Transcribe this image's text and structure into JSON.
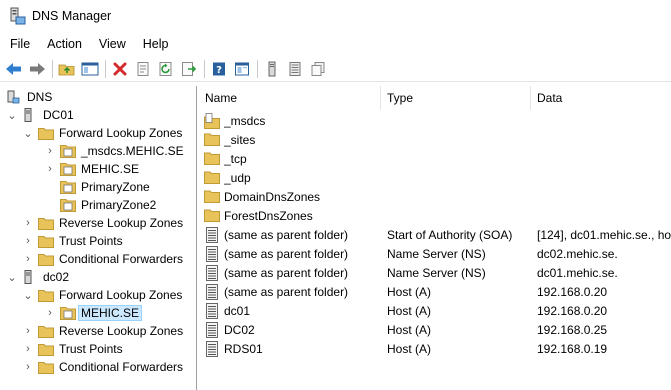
{
  "window": {
    "title": "DNS Manager"
  },
  "menu": [
    "File",
    "Action",
    "View",
    "Help"
  ],
  "toolbar": {
    "buttons": [
      "back-icon",
      "forward-icon",
      "up-folder-icon",
      "show-hide-tree-icon",
      "delete-icon",
      "properties-icon",
      "refresh-icon",
      "export-list-icon",
      "help-icon",
      "mmc-properties-icon",
      "new-server-icon",
      "records-list-icon",
      "copy-icon"
    ]
  },
  "tree": {
    "root": "DNS",
    "dc01": {
      "label": "DC01",
      "forward": "Forward Lookup Zones",
      "zones": [
        "_msdcs.MEHIC.SE",
        "MEHIC.SE",
        "PrimaryZone",
        "PrimaryZone2"
      ],
      "reverse": "Reverse Lookup Zones",
      "trust": "Trust Points",
      "cond": "Conditional Forwarders"
    },
    "dc02": {
      "label": "dc02",
      "forward": "Forward Lookup Zones",
      "zone": "MEHIC.SE",
      "reverse": "Reverse Lookup Zones",
      "trust": "Trust Points",
      "cond": "Conditional Forwarders"
    }
  },
  "list": {
    "columns": [
      "Name",
      "Type",
      "Data"
    ],
    "rows": [
      {
        "icon": "folder-page",
        "name": "_msdcs",
        "type": "",
        "data": ""
      },
      {
        "icon": "folder",
        "name": "_sites",
        "type": "",
        "data": ""
      },
      {
        "icon": "folder",
        "name": "_tcp",
        "type": "",
        "data": ""
      },
      {
        "icon": "folder",
        "name": "_udp",
        "type": "",
        "data": ""
      },
      {
        "icon": "folder",
        "name": "DomainDnsZones",
        "type": "",
        "data": ""
      },
      {
        "icon": "folder",
        "name": "ForestDnsZones",
        "type": "",
        "data": ""
      },
      {
        "icon": "record",
        "name": "(same as parent folder)",
        "type": "Start of Authority (SOA)",
        "data": "[124], dc01.mehic.se., hos"
      },
      {
        "icon": "record",
        "name": "(same as parent folder)",
        "type": "Name Server (NS)",
        "data": "dc02.mehic.se."
      },
      {
        "icon": "record",
        "name": "(same as parent folder)",
        "type": "Name Server (NS)",
        "data": "dc01.mehic.se."
      },
      {
        "icon": "record",
        "name": "(same as parent folder)",
        "type": "Host (A)",
        "data": "192.168.0.20"
      },
      {
        "icon": "record",
        "name": "dc01",
        "type": "Host (A)",
        "data": "192.168.0.20"
      },
      {
        "icon": "record",
        "name": "DC02",
        "type": "Host (A)",
        "data": "192.168.0.25"
      },
      {
        "icon": "record",
        "name": "RDS01",
        "type": "Host (A)",
        "data": "192.168.0.19"
      }
    ]
  },
  "colors": {
    "folder": "#e8c35a",
    "selection": "#cce8ff",
    "accent": "#1a6fc4"
  }
}
